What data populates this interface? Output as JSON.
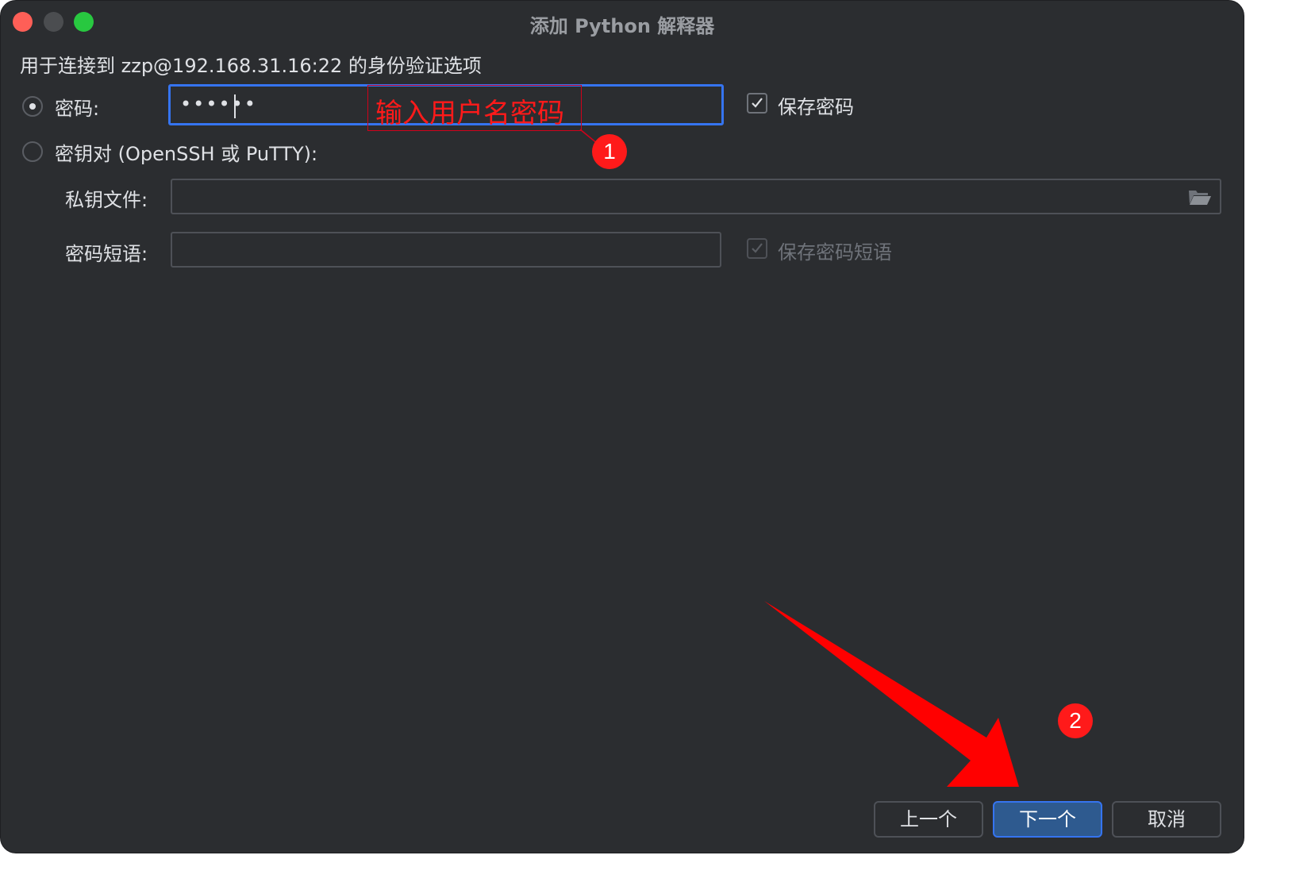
{
  "window": {
    "title": "添加 Python 解释器",
    "subtitle": "用于连接到 zzp@192.168.31.16:22 的身份验证选项"
  },
  "auth": {
    "password_option_label": "密码:",
    "password_value": "••••••",
    "save_password_label": "保存密码",
    "keypair_option_label": "密钥对 (OpenSSH 或 PuTTY):",
    "private_key_label": "私钥文件:",
    "private_key_value": "",
    "passphrase_label": "密码短语:",
    "passphrase_value": "",
    "save_passphrase_label": "保存密码短语"
  },
  "annotations": {
    "hint_text": "输入用户名密码",
    "badge_1": "1",
    "badge_2": "2",
    "color": "#ff1a1a"
  },
  "buttons": {
    "previous": "上一个",
    "next": "下一个",
    "cancel": "取消"
  },
  "icons": {
    "folder": "folder-open-icon",
    "check": "check-icon"
  }
}
